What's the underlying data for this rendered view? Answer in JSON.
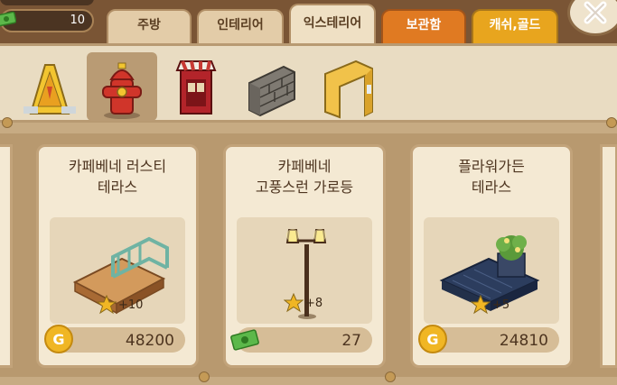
{
  "wallet": {
    "cash_value": "10"
  },
  "tabs": [
    {
      "label": "주방"
    },
    {
      "label": "인테리어"
    },
    {
      "label": "익스테리어"
    },
    {
      "label": "보관함"
    },
    {
      "label": "캐쉬,골드"
    }
  ],
  "categories": [
    {
      "icon": "warning-sign-icon"
    },
    {
      "icon": "fire-hydrant-icon"
    },
    {
      "icon": "awning-shop-icon"
    },
    {
      "icon": "stone-wall-icon"
    },
    {
      "icon": "door-frame-icon"
    }
  ],
  "items": [
    {
      "title_line1": "카페베네 러스티",
      "title_line2": "테라스",
      "bonus": "+10",
      "price": "48200",
      "currency": "gold",
      "coin_letter": "G"
    },
    {
      "title_line1": "카페베네",
      "title_line2": "고풍스런 가로등",
      "bonus": "+8",
      "price": "27",
      "currency": "cash"
    },
    {
      "title_line1": "플라워가든",
      "title_line2": "테라스",
      "bonus": "+5",
      "price": "24810",
      "currency": "gold",
      "coin_letter": "G"
    }
  ]
}
